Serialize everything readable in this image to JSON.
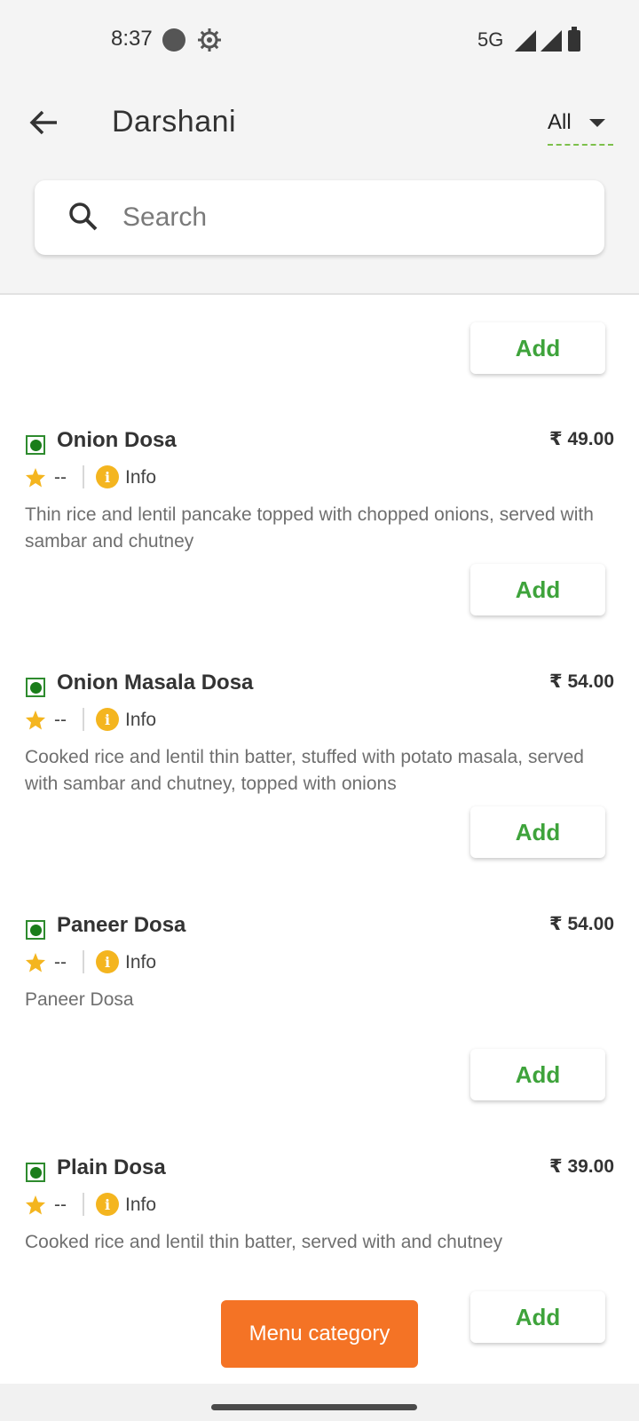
{
  "status_bar": {
    "time": "8:37",
    "network": "5G",
    "icons": [
      "record-dot-icon",
      "gear-icon",
      "signal-icon",
      "signal-icon",
      "battery-icon"
    ]
  },
  "header": {
    "title": "Darshani",
    "filter_label": "All"
  },
  "search": {
    "placeholder": "Search",
    "value": ""
  },
  "add_label": "Add",
  "items": [
    {
      "name": "Onion Dosa",
      "price": "₹ 49.00",
      "rating": "--",
      "info_label": "Info",
      "description": "Thin rice and lentil pancake topped with chopped onions, served with sambar and chutney"
    },
    {
      "name": "Onion Masala Dosa",
      "price": "₹ 54.00",
      "rating": "--",
      "info_label": "Info",
      "description": "Cooked rice and lentil thin batter, stuffed with potato masala, served with sambar and chutney, topped with onions"
    },
    {
      "name": "Paneer Dosa",
      "price": "₹ 54.00",
      "rating": "--",
      "info_label": "Info",
      "description": "Paneer Dosa"
    },
    {
      "name": "Plain Dosa",
      "price": "₹ 39.00",
      "rating": "--",
      "info_label": "Info",
      "description": "Cooked rice and lentil thin batter, served with and chutney"
    }
  ],
  "menu_category_label": "Menu category",
  "colors": {
    "accent_green": "#3ea33b",
    "veg_green": "#1a7d1a",
    "star_yellow": "#f4b51f",
    "menu_orange": "#f47325"
  }
}
